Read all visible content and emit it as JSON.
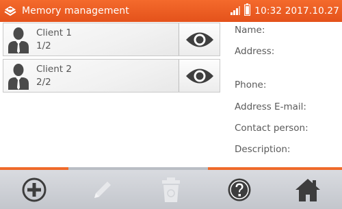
{
  "header": {
    "title": "Memory management",
    "time": "10:32 2017.10.27",
    "app_icon": "memory-card-icon",
    "signal_icon": "signal-bars-icon",
    "battery_icon": "battery-icon"
  },
  "clients": [
    {
      "name": "Client 1",
      "count": "1/2",
      "icon": "person-icon",
      "action_icon": "eye-icon"
    },
    {
      "name": "Client 2",
      "count": "2/2",
      "icon": "person-icon",
      "action_icon": "eye-icon"
    }
  ],
  "details": {
    "name": "Name:",
    "address": "Address:",
    "phone": "Phone:",
    "email": "Address E-mail:",
    "contact": "Contact person:",
    "description": "Description:"
  },
  "toolbar": {
    "add": {
      "icon": "plus-circle-icon",
      "enabled": true
    },
    "edit": {
      "icon": "pencil-icon",
      "enabled": false
    },
    "delete": {
      "icon": "trash-icon",
      "enabled": false
    },
    "help": {
      "icon": "question-circle-icon",
      "enabled": true
    },
    "home": {
      "icon": "home-icon",
      "enabled": true
    }
  },
  "colors": {
    "accent": "#ef6a2a",
    "header": "#e85a20",
    "toolbar_bg": "#cfd2d7",
    "icon_active": "#3d3d3d",
    "icon_disabled": "#e7e8eb"
  }
}
